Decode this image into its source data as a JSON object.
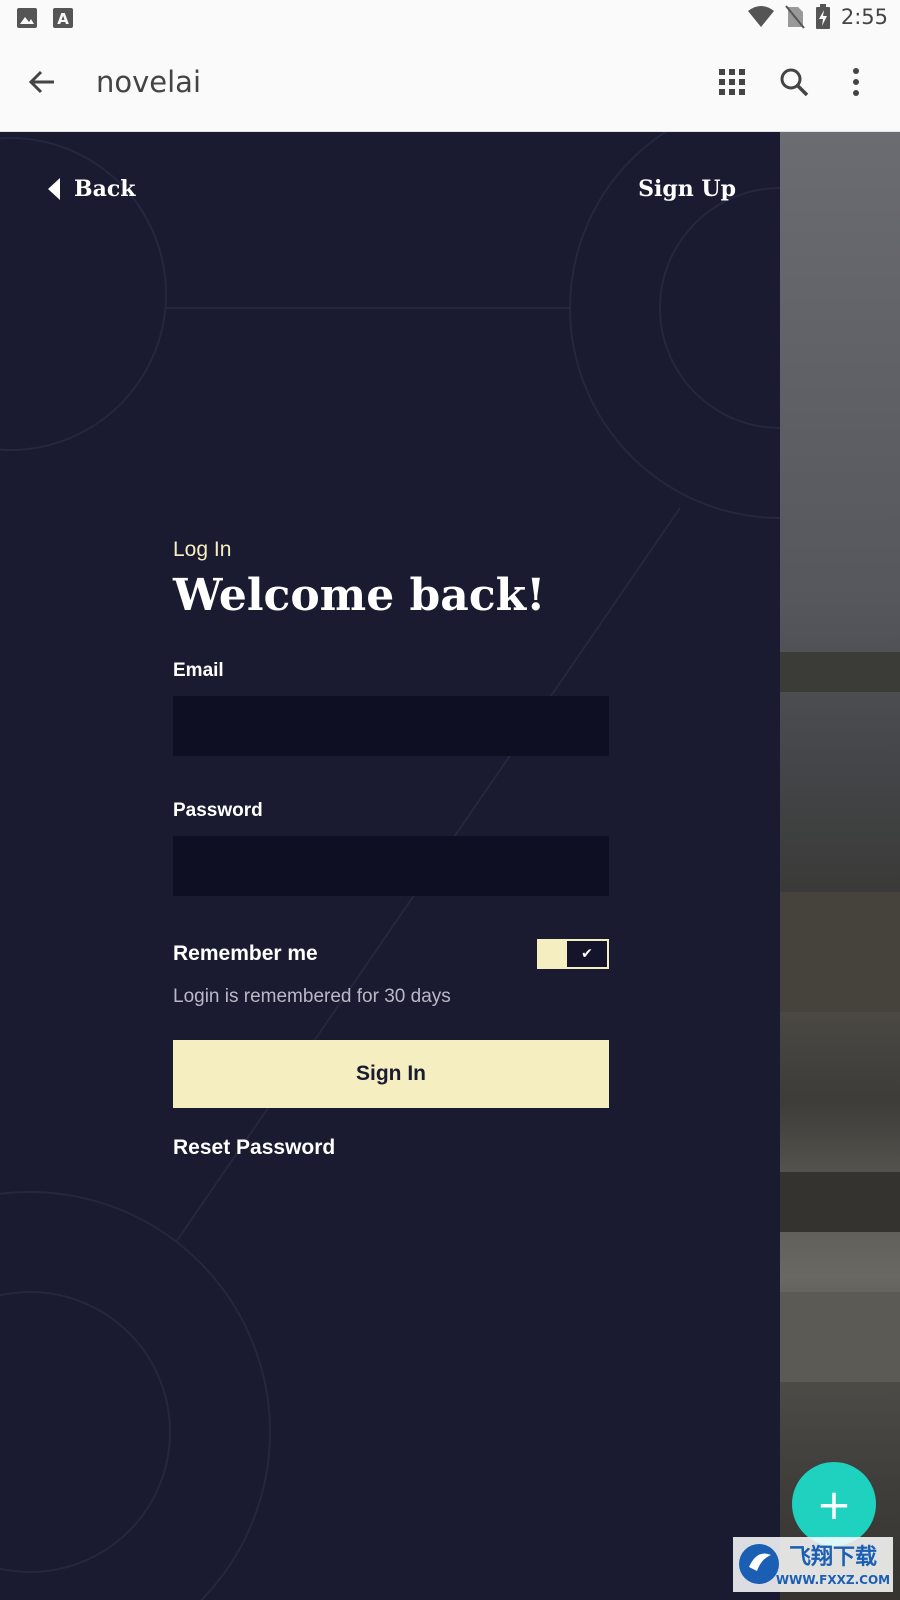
{
  "status_bar": {
    "time": "2:55"
  },
  "app_bar": {
    "title": "novelai"
  },
  "nav": {
    "back_label": "Back",
    "signup_label": "Sign Up"
  },
  "form": {
    "eyebrow": "Log In",
    "heading": "Welcome back!",
    "email_label": "Email",
    "email_value": "",
    "password_label": "Password",
    "password_value": "",
    "remember_label": "Remember me",
    "remember_checked": true,
    "remember_hint": "Login is remembered for 30 days",
    "signin_label": "Sign In",
    "reset_label": "Reset Password"
  },
  "fab": {
    "icon": "plus-icon"
  },
  "watermark": {
    "brand": "飞翔下载",
    "url": "WWW.FXXZ.COM"
  },
  "colors": {
    "panel_bg": "#1a1b30",
    "input_bg": "#0e0f22",
    "accent": "#f4eec1",
    "fab": "#1fd1bf"
  }
}
